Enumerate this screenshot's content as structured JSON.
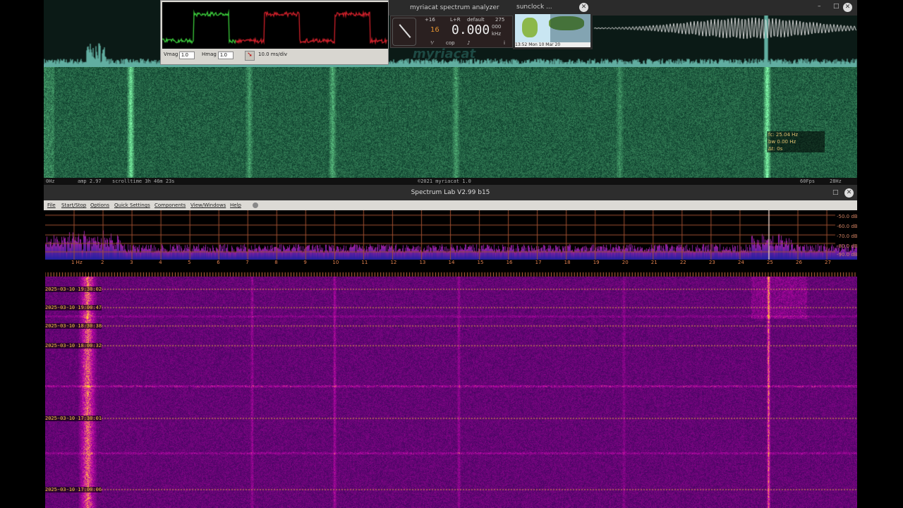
{
  "top_window": {
    "title": "myriacat spectrum analyzer",
    "status": {
      "left": "0Hz",
      "amp": "amp 2.97",
      "scrolltime": "scrolltime 3h 46m 23s",
      "credit": "©2021 myriacat 1.0",
      "fps": "60Fps",
      "right": "28Hz"
    },
    "tooltip": {
      "fc": "fc: 25.04 Hz",
      "bw": "bw 0.00 Hz",
      "dt": "Δt: 0s"
    },
    "controls": {
      "minimize": "–",
      "maximize": "□",
      "close": "✕"
    }
  },
  "scope": {
    "vmag_label": "Vmag",
    "vmag_value": "1.0",
    "hmag_label": "Hmag",
    "hmag_value": "1.0",
    "timebase": "10.0 ms/div",
    "trace_colors": [
      "#3ccf3c",
      "#d0202a"
    ]
  },
  "analyzer": {
    "gain": "+16",
    "channel": "L+R",
    "preset": "default",
    "value_275": "275",
    "digit": "16",
    "frequency": "0.000",
    "sub": "000",
    "unit": "kHz",
    "buttons": [
      "⅟",
      "cop",
      "♪"
    ],
    "info": "i",
    "watermark": "myriacat"
  },
  "sunclock": {
    "title": "sunclock ...",
    "caption": "13:52 Mon 10 Mar 20"
  },
  "spectrum_lab": {
    "title": "Spectrum Lab V2.99 b15",
    "menu": [
      "File",
      "Start/Stop",
      "Options",
      "Quick Settings",
      "Components",
      "View/Windows",
      "Help"
    ],
    "db_labels": [
      "-50.0 dB",
      "-60.0 dB",
      "-70.0 dB",
      "-80.0 dB",
      "-90.0 dB"
    ],
    "freq_labels": [
      "1 Hz",
      "2",
      "3",
      "4",
      "5",
      "6",
      "7",
      "8",
      "9",
      "10",
      "11",
      "12",
      "13",
      "14",
      "15",
      "16",
      "17",
      "18",
      "19",
      "20",
      "21",
      "22",
      "23",
      "24",
      "25",
      "26",
      "27"
    ],
    "timestamps": [
      "2025-03-10 19:30:02",
      "2025-03-10 19:00:47",
      "2025-03-10 18:30:38",
      "2025-03-10 18:00:32",
      "2025-03-10 17:30:01",
      "2025-03-10 17:00:06"
    ]
  }
}
